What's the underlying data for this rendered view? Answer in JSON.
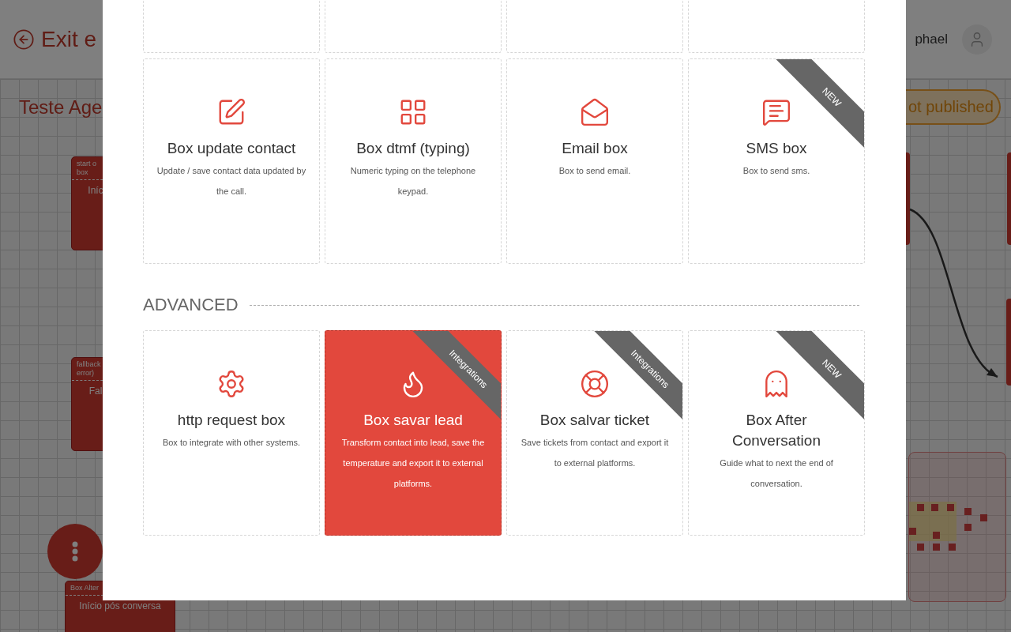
{
  "header": {
    "exit_label": "Exit e",
    "user_name": "phael"
  },
  "canvas": {
    "title": "Teste Age",
    "status": "ot published",
    "nodes": [
      {
        "header": [
          "start o",
          "box"
        ],
        "label": "Iníc"
      },
      {
        "header": [
          "fallback",
          "error)"
        ],
        "label": "Fal"
      },
      {
        "header": [
          "Box Alter"
        ],
        "label": "Início pós conversa"
      }
    ]
  },
  "modal": {
    "sections": [
      {
        "cards": [
          {
            "kind": "clipped",
            "selected": false
          },
          {
            "kind": "clipped",
            "selected": false
          },
          {
            "kind": "clipped",
            "selected": false
          },
          {
            "kind": "clipped",
            "selected": false
          },
          {
            "kind": "full",
            "selected": false,
            "title": "Box update contact",
            "description": "Update / save contact data updated by the call."
          },
          {
            "kind": "full",
            "selected": false,
            "title": "Box dtmf (typing)",
            "description": "Numeric typing on the telephone keypad."
          },
          {
            "kind": "full",
            "selected": false,
            "title": "Email box",
            "description": "Box to send email."
          },
          {
            "kind": "full",
            "selected": false,
            "title": "SMS box",
            "description": "Box to send sms.",
            "ribbon": "NEW"
          }
        ]
      },
      {
        "title": "ADVANCED",
        "cards": [
          {
            "kind": "full",
            "selected": false,
            "title": "http request box",
            "description": "Box to integrate with other systems."
          },
          {
            "kind": "full",
            "selected": true,
            "title": "Box savar lead",
            "description": "Transform contact into lead, save the temperature and export it to external platforms.",
            "ribbon": "Integrations"
          },
          {
            "kind": "full",
            "selected": false,
            "title": "Box salvar ticket",
            "description": "Save tickets from contact and export it to external platforms.",
            "ribbon": "Integrations"
          },
          {
            "kind": "full",
            "selected": false,
            "title": "Box After Conversation",
            "description": "Guide what to next the end of conversation.",
            "ribbon": "NEW"
          }
        ]
      }
    ]
  }
}
